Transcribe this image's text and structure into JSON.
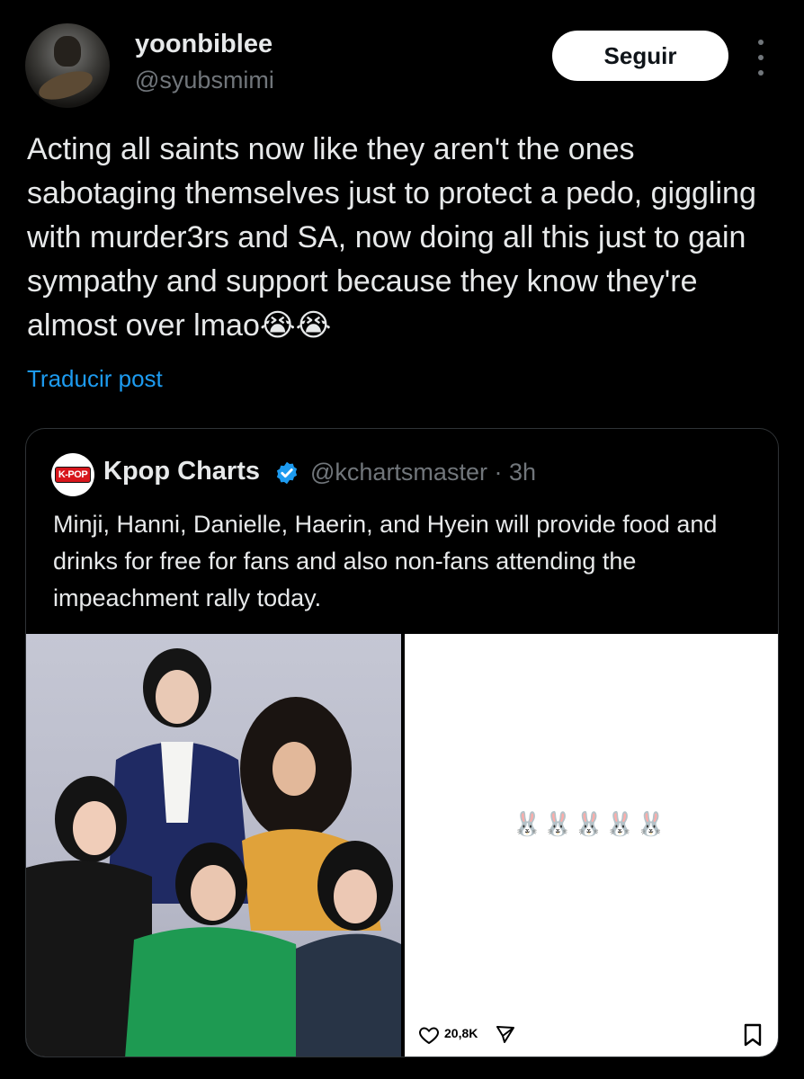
{
  "author": {
    "display_name": "yoonbiblee",
    "handle": "@syubsmimi",
    "follow_label": "Seguir"
  },
  "post": {
    "text": "Acting all saints now like they aren't the ones sabotaging themselves just to protect a pedo, giggling with murder3rs and SA, now doing all this just to gain sympathy and support because they know they're almost over lmao😭😭",
    "translate_label": "Traducir post"
  },
  "quoted_post": {
    "avatar_label": "K-POP",
    "display_name": "Kpop Charts",
    "handle": "@kchartsmaster",
    "time": "· 3h",
    "text": "Minji, Hanni, Danielle, Haerin, and Hyein will provide food and drinks for free for fans and also non-fans attending the impeachment rally today.",
    "media_right": {
      "bunnies": "🐰🐰🐰🐰🐰",
      "like_count": "20,8K"
    }
  },
  "icons": [
    "more-vertical-icon",
    "verified-badge-icon",
    "heart-icon",
    "send-icon",
    "bookmark-icon"
  ],
  "colors": {
    "background": "#000000",
    "link": "#1d9bf0",
    "verified": "#1d9bf0",
    "muted": "#71767b"
  }
}
